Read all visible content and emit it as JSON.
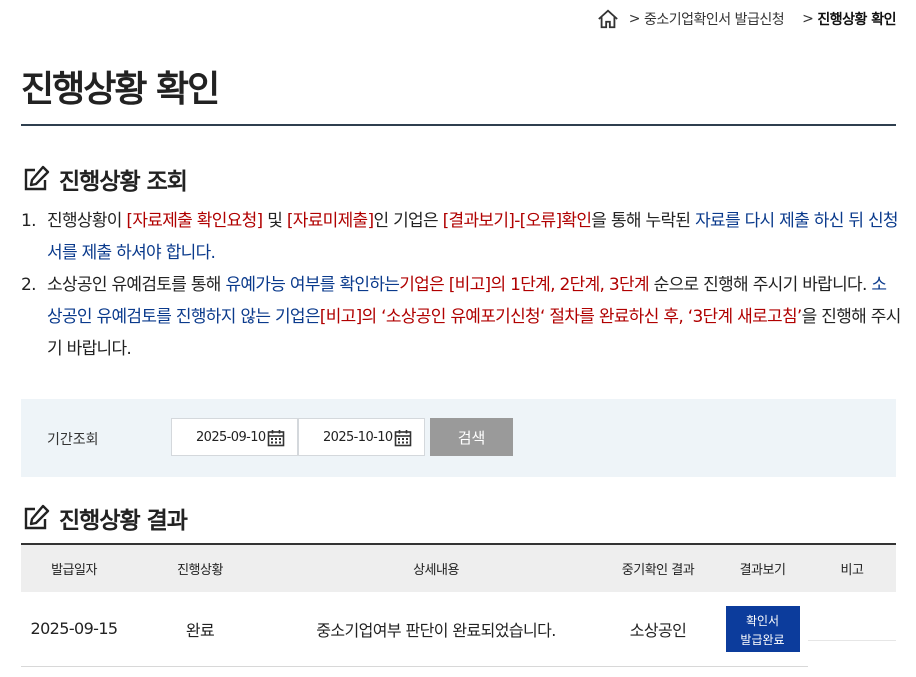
{
  "breadcrumb": {
    "items": [
      "중소기업확인서 발급신청",
      "진행상황 확인"
    ]
  },
  "page_title": "진행상황 확인",
  "status_section": {
    "title": "진행상황 조회",
    "notes": [
      {
        "num": "1.",
        "parts": [
          {
            "t": "진행상황이 ",
            "c": ""
          },
          {
            "t": "[자료제출 확인요청]",
            "c": "red"
          },
          {
            "t": " 및 ",
            "c": ""
          },
          {
            "t": "[자료미제출]",
            "c": "red"
          },
          {
            "t": "인 기업은 ",
            "c": ""
          },
          {
            "t": "[결과보기]-[오류]확인",
            "c": "red"
          },
          {
            "t": "을 통해 누락된 ",
            "c": ""
          },
          {
            "t": "자료를 다시 제출 하신 뒤 신청서를 제출 하셔야 합니다.",
            "c": "blue"
          }
        ]
      },
      {
        "num": "2.",
        "parts": [
          {
            "t": "소상공인 유예검토를 통해 ",
            "c": ""
          },
          {
            "t": "유예가능 여부를 확인하는",
            "c": "blue"
          },
          {
            "t": "기업은 ",
            "c": "red"
          },
          {
            "t": "[비고]의 1단계, 2단계, 3단계",
            "c": "red"
          },
          {
            "t": " 순으로 진행해 주시기 바랍니다. ",
            "c": ""
          },
          {
            "t": "소상공인 유예검토를 진행하지 않는 기업은",
            "c": "blue"
          },
          {
            "t": "[비고]의 ‘소상공인 유예포기신청‘ 절차를 완료하신 후, ‘3단계 새로고침’",
            "c": "red"
          },
          {
            "t": "을 진행해 주시기 바랍니다.",
            "c": ""
          }
        ]
      }
    ]
  },
  "search": {
    "label": "기간조회",
    "date_from": "2025-09-10",
    "date_to": "2025-10-10",
    "button_label": "검색"
  },
  "result_section": {
    "title": "진행상황 결과",
    "columns": [
      "발급일자",
      "진행상황",
      "상세내용",
      "중기확인 결과",
      "결과보기",
      "비고"
    ],
    "rows": [
      {
        "issue_date": "2025-09-15",
        "status": "완료",
        "detail": "중소기업여부 판단이 완료되었습니다.",
        "result": "소상공인",
        "view_button": [
          "확인서",
          "발급완료"
        ],
        "remark": ""
      }
    ]
  },
  "colors": {
    "accent_red": "#b00000",
    "accent_blue": "#0a3a8c",
    "button_blue": "#0c3c9c",
    "search_bg": "#eef4f8"
  }
}
